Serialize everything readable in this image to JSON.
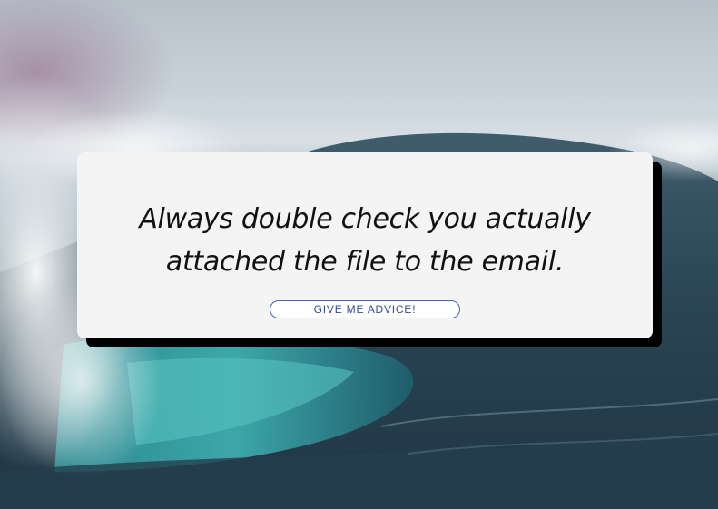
{
  "advice": {
    "text": "Always double check you actually attached the file to the email."
  },
  "button": {
    "label": "GIVE ME ADVICE!"
  },
  "colors": {
    "card": "#f4f4f4",
    "shadow": "#000000",
    "button_border": "#4a63b8",
    "button_text": "#2f4aa4"
  }
}
